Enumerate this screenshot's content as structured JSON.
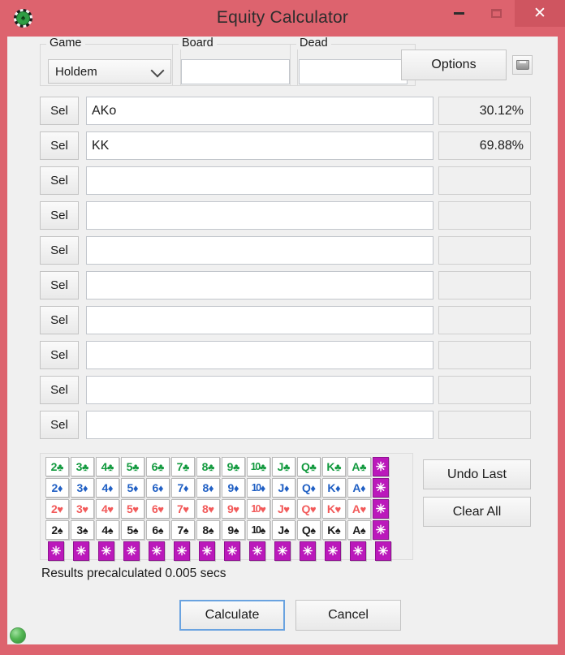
{
  "window": {
    "title": "Equity Calculator",
    "icon": "poker-chip-icon",
    "controls": {
      "minimize": "–",
      "maximize": "□",
      "close": "✕"
    },
    "accent_titlebar": "#dd636e",
    "accent_close": "#cf5560"
  },
  "top": {
    "game_label": "Game",
    "game_value": "Holdem",
    "board_label": "Board",
    "board_value": "",
    "board_placeholder": "",
    "dead_label": "Dead",
    "dead_value": "",
    "dead_placeholder": "",
    "options_label": "Options",
    "save_icon": "save-disk-icon"
  },
  "players": {
    "sel_label": "Sel",
    "rows": [
      {
        "hand": "AKo",
        "equity": "30.12%",
        "enabled": true
      },
      {
        "hand": "KK",
        "equity": "69.88%",
        "enabled": true
      },
      {
        "hand": "",
        "equity": "",
        "enabled": false
      },
      {
        "hand": "",
        "equity": "",
        "enabled": false
      },
      {
        "hand": "",
        "equity": "",
        "enabled": false
      },
      {
        "hand": "",
        "equity": "",
        "enabled": false
      },
      {
        "hand": "",
        "equity": "",
        "enabled": false
      },
      {
        "hand": "",
        "equity": "",
        "enabled": false
      },
      {
        "hand": "",
        "equity": "",
        "enabled": false
      },
      {
        "hand": "",
        "equity": "",
        "enabled": false
      }
    ]
  },
  "card_grid": {
    "ranks": [
      "2",
      "3",
      "4",
      "5",
      "6",
      "7",
      "8",
      "9",
      "10",
      "J",
      "Q",
      "K",
      "A"
    ],
    "star_glyph": "✳",
    "suit_rows": [
      {
        "suit": "clubs",
        "glyph": "♣",
        "color": "#139a3f",
        "class": "suit-c"
      },
      {
        "suit": "diamonds",
        "glyph": "♦",
        "color": "#2160c4",
        "class": "suit-d"
      },
      {
        "suit": "hearts",
        "glyph": "♥",
        "color": "#f25a5a",
        "class": "suit-h"
      },
      {
        "suit": "spades",
        "glyph": "♠",
        "color": "#1e1e1e",
        "class": "suit-s"
      }
    ],
    "star_row_count": 14,
    "star_color": "#bb19bb"
  },
  "side_buttons": {
    "undo_label": "Undo Last",
    "clear_label": "Clear All"
  },
  "footer": {
    "status": "Results precalculated 0.005 secs",
    "calculate_label": "Calculate",
    "cancel_label": "Cancel",
    "led": "status-led-green"
  }
}
